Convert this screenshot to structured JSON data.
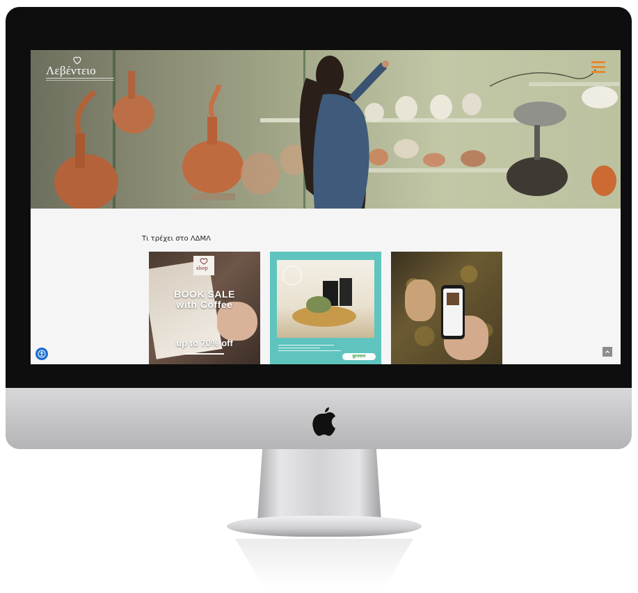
{
  "site": {
    "logo_text": "Λεβέντειο",
    "section_title": "Τι τρέχει στο ΛΔΜΛ"
  },
  "cards": [
    {
      "shop_label": "shop",
      "headline_line1": "BOOK SALE",
      "headline_line2": "with Coffee",
      "discount": "up to 70% off"
    },
    {
      "badge": "green"
    },
    {}
  ],
  "colors": {
    "accent_menu": "#e48a2e",
    "card2_background": "#5fc4be",
    "accessibility_blue": "#1c6fd1",
    "screen_background": "#f5f5f6",
    "device_bezel": "#0e0e0e"
  },
  "icons": {
    "menu": "hamburger-icon",
    "accessibility": "accessibility-icon",
    "scroll_top": "chevron-up-icon",
    "device_logo": "apple-icon"
  }
}
